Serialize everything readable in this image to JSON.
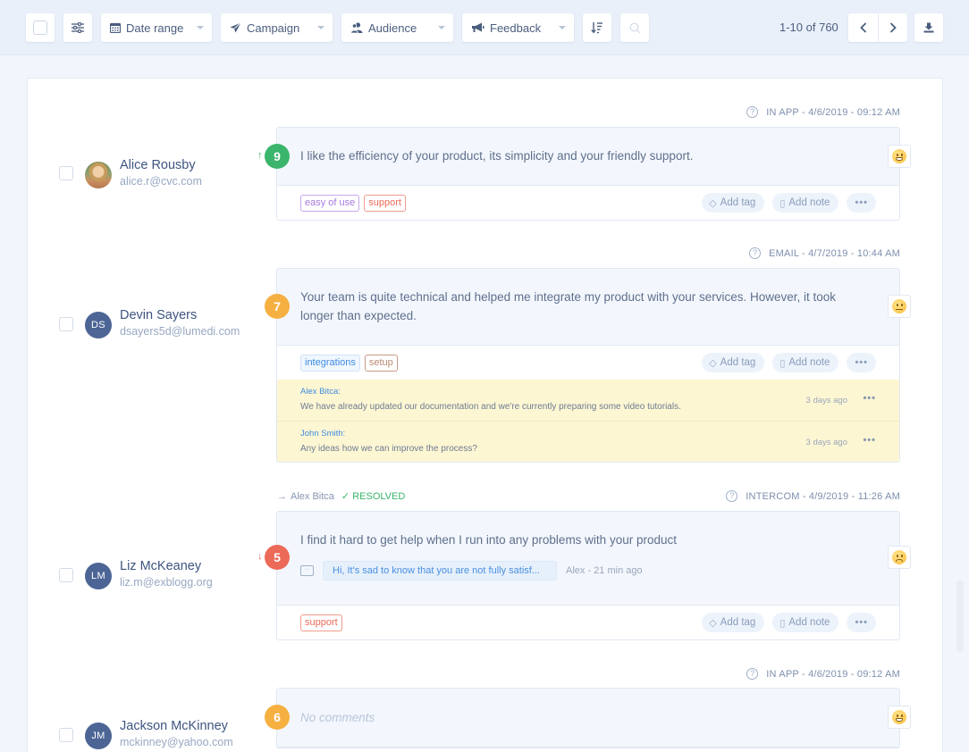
{
  "toolbar": {
    "filters": [
      {
        "label": "Date range",
        "icon": "calendar-icon"
      },
      {
        "label": "Campaign",
        "icon": "paper-plane-icon"
      },
      {
        "label": "Audience",
        "icon": "audience-icon"
      },
      {
        "label": "Feedback",
        "icon": "megaphone-icon"
      }
    ],
    "pager_text": "1-10 of 760",
    "prev_icon": "‹",
    "next_icon": "›"
  },
  "entries": [
    {
      "user": {
        "name": "Alice Rousby",
        "email": "alice.r@cvc.com",
        "initials": "",
        "avatar": "photo"
      },
      "meta": "IN APP -  4/6/2019 - 09:12 AM",
      "score": "9",
      "score_color": "#3bb56b",
      "trend": "up",
      "trend_glyph": "↑",
      "text": "I like the efficiency of your product, its simplicity and your friendly support.",
      "sentiment": "grin",
      "tags": [
        {
          "label": "easy of use",
          "style": "purple"
        },
        {
          "label": "support",
          "style": "red"
        }
      ]
    },
    {
      "user": {
        "name": "Devin Sayers",
        "email": "dsayers5d@lumedi.com",
        "initials": "DS"
      },
      "meta": "EMAIL -  4/7/2019 - 10:44 AM",
      "score": "7",
      "score_color": "#f5b041",
      "text": "Your team is quite technical and helped me integrate my product with your services. However, it took longer than expected.",
      "sentiment": "neutral",
      "tags": [
        {
          "label": "integrations",
          "style": "blue"
        },
        {
          "label": "setup",
          "style": "brown"
        }
      ],
      "notes": [
        {
          "author": "Alex Bitca:",
          "text": "We have already updated our documentation and we're currently preparing some video tutorials.",
          "ago": "3 days ago"
        },
        {
          "author": "John Smith:",
          "text": "Any ideas how we can improve the process?",
          "ago": "3 days ago"
        }
      ]
    },
    {
      "user": {
        "name": "Liz McKeaney",
        "email": "liz.m@exblogg.org",
        "initials": "LM"
      },
      "assigned_to": "Alex Bitca",
      "status": "RESOLVED",
      "meta": "INTERCOM -  4/9/2019 - 11:26 AM",
      "score": "5",
      "score_color": "#ec6a58",
      "trend": "down",
      "trend_glyph": "↓",
      "text": "I find it hard to get help when I run into any problems with your product",
      "reply": {
        "text": "Hi, It's sad to know that you are not fully satisf...",
        "meta": "Alex - 21 min ago"
      },
      "sentiment": "sad",
      "tags": [
        {
          "label": "support",
          "style": "red"
        }
      ]
    },
    {
      "user": {
        "name": "Jackson McKinney",
        "email": "mckinney@yahoo.com",
        "initials": "JM"
      },
      "meta": "IN APP -  4/6/2019 - 09:12 AM",
      "score": "6",
      "score_color": "#f5b041",
      "text": "No comments",
      "sentiment": "grin"
    }
  ],
  "actions": {
    "add_tag": "Add tag",
    "add_note": "Add note",
    "more": "•••"
  },
  "icons": {
    "arrow_right": "→",
    "check": "✓",
    "question": "?"
  }
}
